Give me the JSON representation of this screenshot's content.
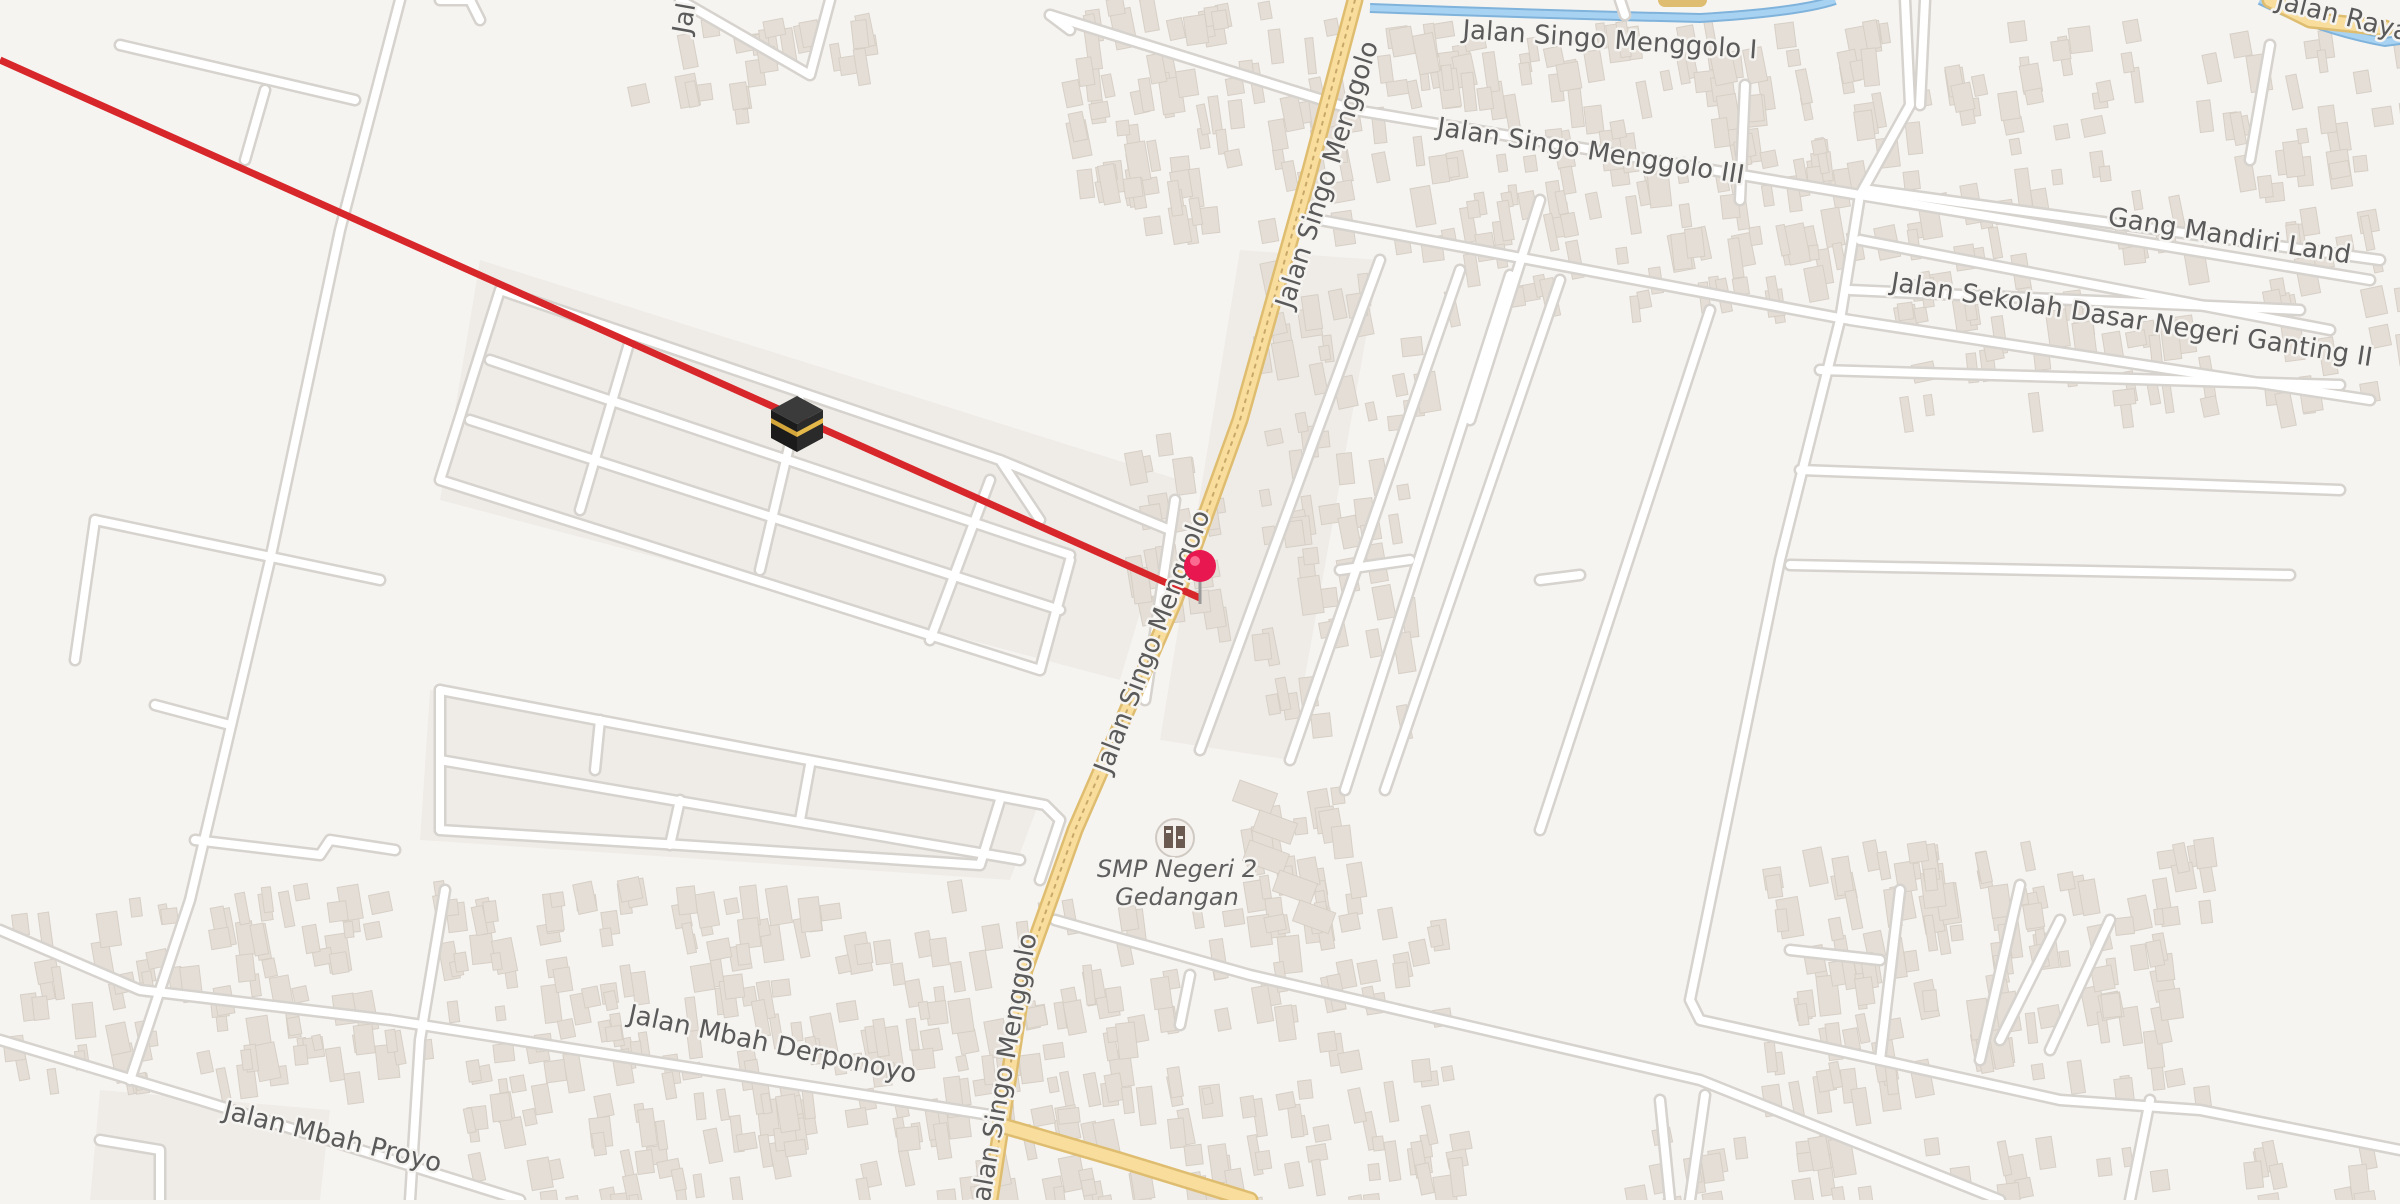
{
  "map": {
    "street_labels": [
      "Jalan Singo Menggolo I",
      "Jalan Singo Menggolo III",
      "Gang Mandiri Land",
      "Jalan Sekolah Dasar Negeri Ganting II",
      "Jalan Singo Menggolo",
      "Jalan Singo Menggolo",
      "Jalan Mbah Derponoyo",
      "Jalan Mbah Proyo",
      "Jalan Raya",
      "Jal"
    ],
    "poi": {
      "name_line1": "SMP Negeri 2",
      "name_line2": "Gedangan",
      "icon": "school-icon"
    },
    "markers": {
      "kaaba": "kaaba-icon",
      "pin": "location-pin-icon"
    },
    "colors": {
      "background": "#f6f4f1",
      "road": "#ffffff",
      "road_casing": "#d9d5d0",
      "main_road": "#f7dc9a",
      "main_road_casing": "#e0bd6e",
      "building": "#e6e1da",
      "qibla_line": "#d8272b",
      "pin": "#e8174f",
      "river": "#9ccbef"
    }
  }
}
